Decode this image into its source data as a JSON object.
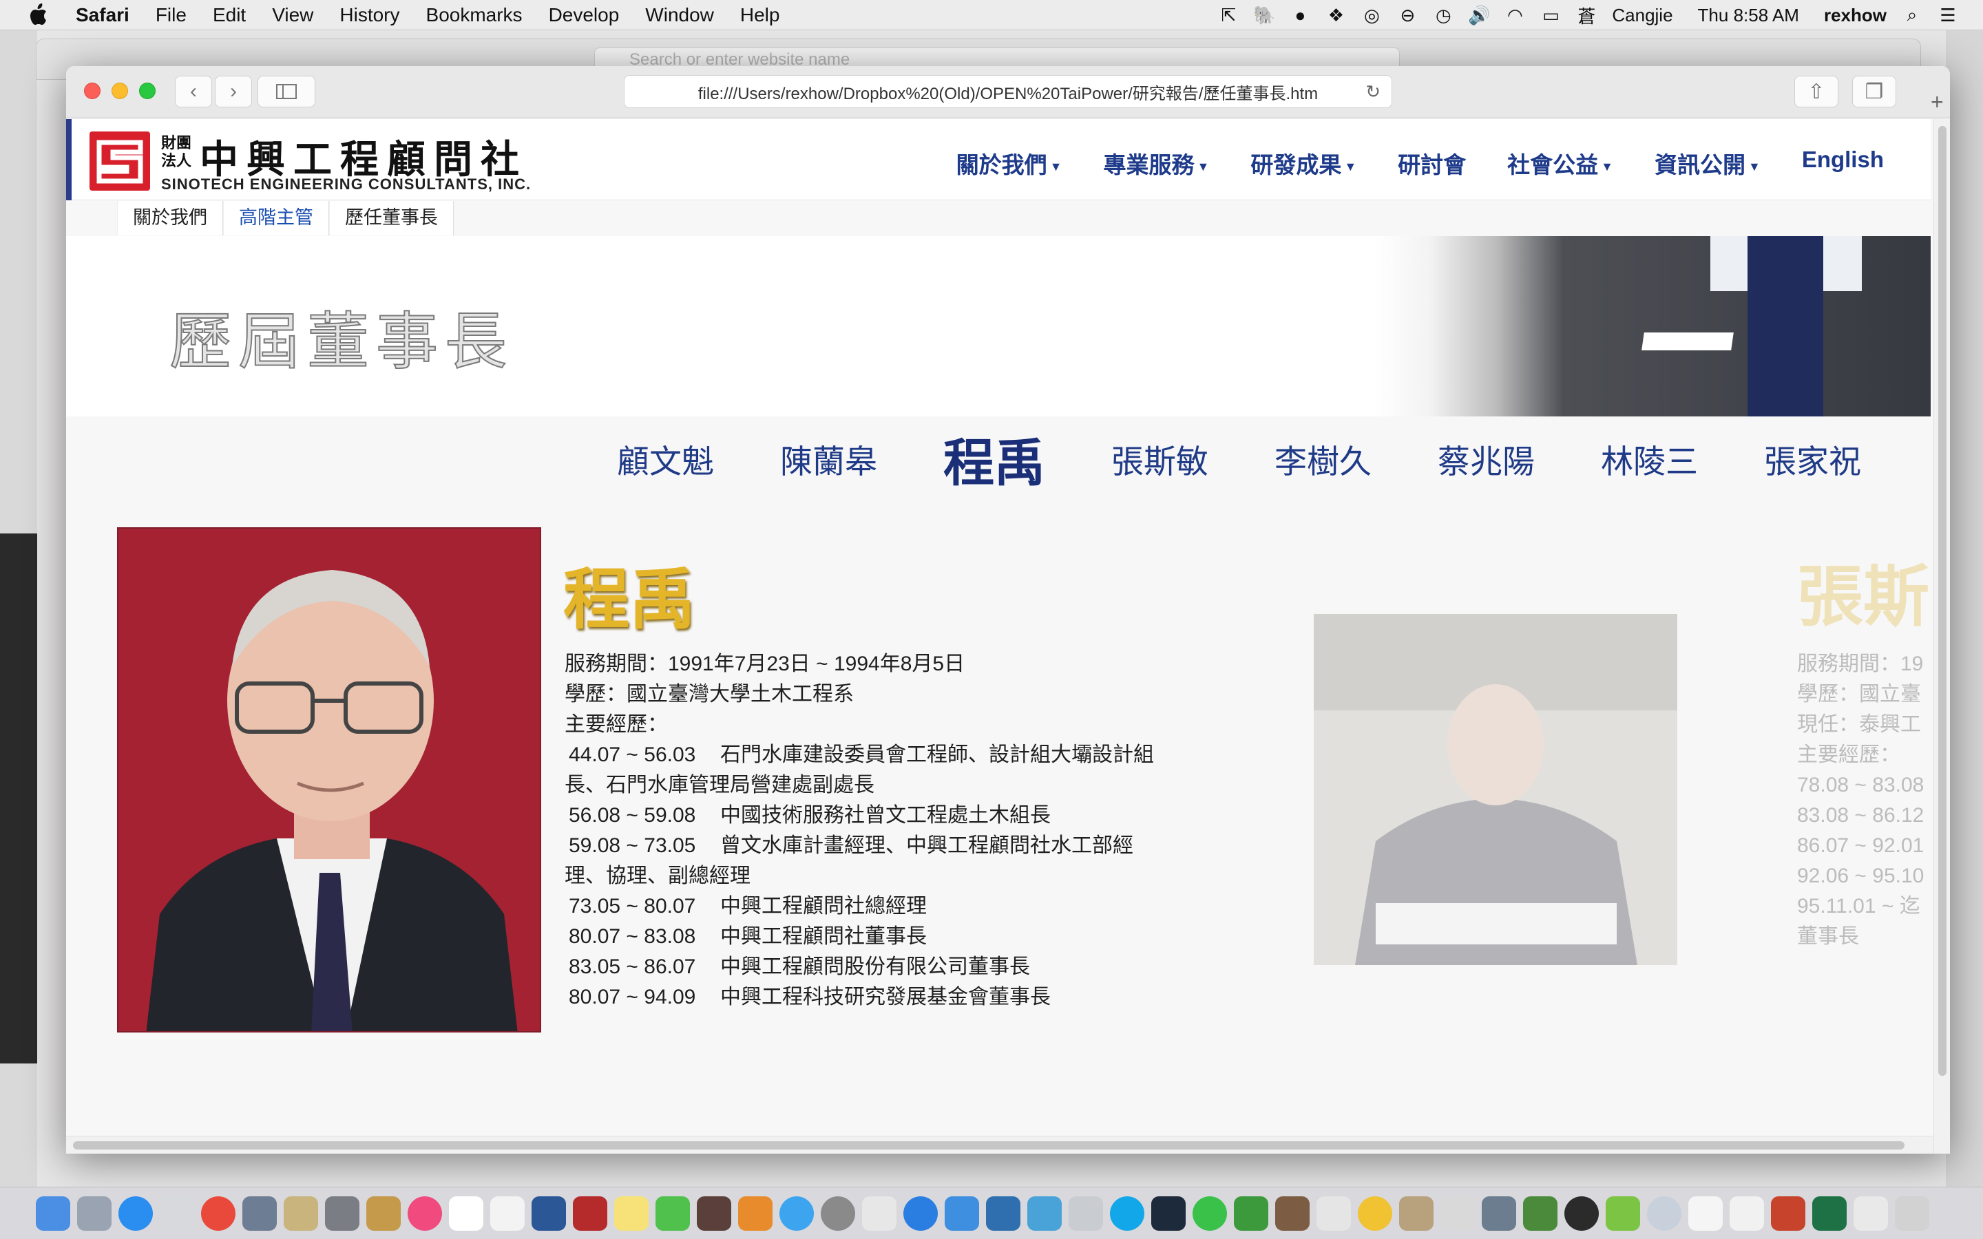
{
  "menubar": {
    "app": "Safari",
    "items": [
      "File",
      "Edit",
      "View",
      "History",
      "Bookmarks",
      "Develop",
      "Window",
      "Help"
    ],
    "input_method": "Cangjie",
    "clock": "Thu 8:58 AM",
    "user": "rexhow"
  },
  "back_window": {
    "search_placeholder": "Search or enter website name"
  },
  "browser": {
    "url": "file:///Users/rexhow/Dropbox%20(Old)/OPEN%20TaiPower/研究報告/歷任董事長.htm"
  },
  "site": {
    "logo_small": "財團法人",
    "logo_name": "中興工程顧問社",
    "logo_english": "SINOTECH ENGINEERING CONSULTANTS, INC.",
    "nav": [
      {
        "label": "關於我們",
        "dropdown": true
      },
      {
        "label": "專業服務",
        "dropdown": true
      },
      {
        "label": "研發成果",
        "dropdown": true
      },
      {
        "label": "研討會",
        "dropdown": false
      },
      {
        "label": "社會公益",
        "dropdown": true
      },
      {
        "label": "資訊公開",
        "dropdown": true
      },
      {
        "label": "English",
        "dropdown": false
      }
    ],
    "breadcrumb": [
      "關於我們",
      "高階主管",
      "歷任董事長"
    ]
  },
  "hero": {
    "title": "歷屆董事長"
  },
  "chairmen": {
    "names": [
      "顧文魁",
      "陳蘭皋",
      "程禹",
      "張斯敏",
      "李樹久",
      "蔡兆陽",
      "林陵三",
      "張家祝"
    ],
    "active": "程禹"
  },
  "profile": {
    "name": "程禹",
    "term": "服務期間：1991年7月23日 ~ 1994年8月5日",
    "education": "學歷：國立臺灣大學土木工程系",
    "experience_label": "主要經歷：",
    "experience": [
      {
        "period": "44.07 ~ 56.03",
        "desc": "石門水庫建設委員會工程師、設計組大壩設計組長、石門水庫管理局營建處副處長"
      },
      {
        "period": "56.08 ~ 59.08",
        "desc": "中國技術服務社曾文工程處土木組長"
      },
      {
        "period": "59.08 ~ 73.05",
        "desc": "曾文水庫計畫經理、中興工程顧問社水工部經理、協理、副總經理"
      },
      {
        "period": "73.05 ~ 80.07",
        "desc": "中興工程顧問社總經理"
      },
      {
        "period": "80.07 ~ 83.08",
        "desc": "中興工程顧問社董事長"
      },
      {
        "period": "83.05 ~ 86.07",
        "desc": "中興工程顧問股份有限公司董事長"
      },
      {
        "period": "80.07 ~ 94.09",
        "desc": "中興工程科技研究發展基金會董事長"
      }
    ]
  },
  "next_profile": {
    "name": "張斯",
    "lines": [
      "服務期間：19",
      "學歷：國立臺",
      "現任：泰興工",
      "主要經歷：",
      " 78.08 ~ 83.08",
      " 83.08 ~ 86.12",
      " 86.07 ~ 92.01",
      " 92.06 ~ 95.10",
      " 95.11.01 ~ 迄",
      "董事長"
    ]
  },
  "colors": {
    "nav_blue": "#1e3a8a",
    "brand_red": "#d8202c",
    "name_gold": "#e4b528"
  }
}
